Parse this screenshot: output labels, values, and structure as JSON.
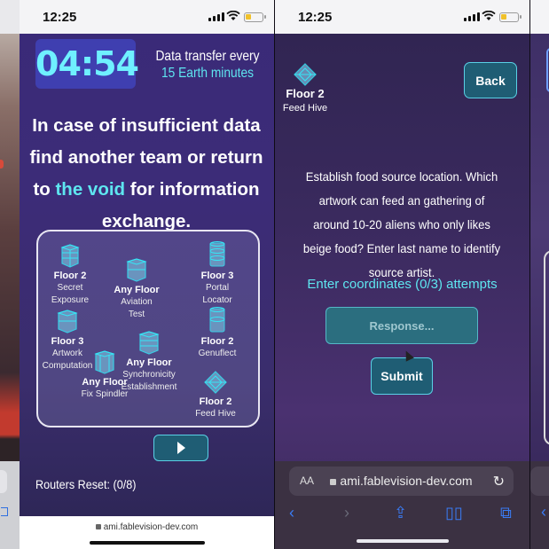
{
  "status": {
    "time": "12:25"
  },
  "screen1": {
    "timer": "04:54",
    "transfer_line1": "Data transfer every",
    "transfer_line2": "15 Earth minutes",
    "headline_part1": "In case of insufficient data find another team or return to ",
    "headline_hl": "the void",
    "headline_part2": " for information exchange.",
    "nodes": [
      {
        "name": "Floor 2",
        "sub1": "Secret",
        "sub2": "Exposure"
      },
      {
        "name": "Any Floor",
        "sub1": "Aviation",
        "sub2": "Test"
      },
      {
        "name": "Floor 3",
        "sub1": "Portal",
        "sub2": "Locator"
      },
      {
        "name": "Floor 3",
        "sub1": "Artwork",
        "sub2": "Computation"
      },
      {
        "name": "Any Floor",
        "sub1": "Fix Spindler",
        "sub2": ""
      },
      {
        "name": "Any Floor",
        "sub1": "Synchronicity",
        "sub2": "Establishment"
      },
      {
        "name": "Floor 2",
        "sub1": "Genuflect",
        "sub2": ""
      },
      {
        "name": "Floor 2",
        "sub1": "Feed Hive",
        "sub2": ""
      }
    ],
    "routers": "Routers Reset: (0/8)",
    "url": "ami.fablevision-dev.com"
  },
  "screen2": {
    "location_name": "Floor 2",
    "location_sub": "Feed Hive",
    "back_label": "Back",
    "question": "Establish food source location. Which artwork can feed an gathering of around 10-20 aliens who only likes beige food? Enter last name to identify source artist.",
    "attempts": "Enter coordinates (0/3) attempts",
    "response_placeholder": "Response...",
    "submit_label": "Submit",
    "aa": "AA",
    "url": "ami.fablevision-dev.com"
  },
  "colors": {
    "accent": "#5ee6f0",
    "button": "#1f5d74",
    "timer_bg": "#3f3fb0",
    "safari_blue": "#3a7cf5"
  }
}
